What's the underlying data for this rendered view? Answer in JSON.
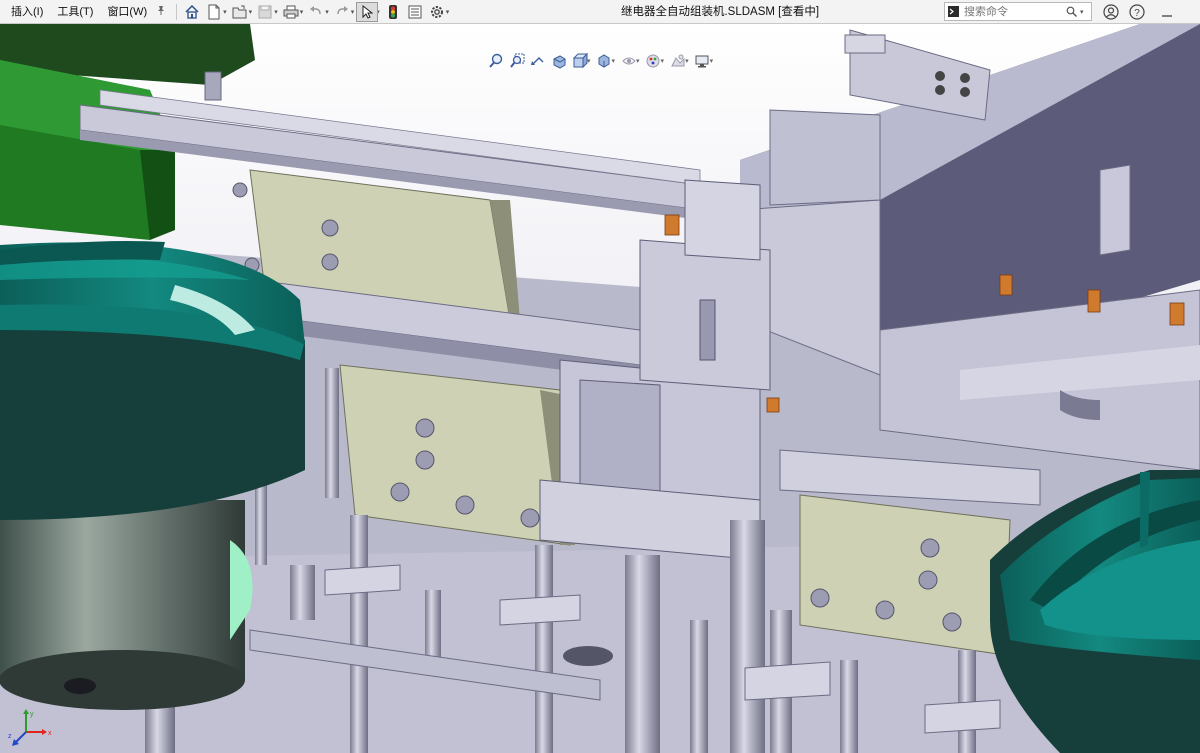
{
  "menu": {
    "items": [
      {
        "label": "插入(I)"
      },
      {
        "label": "工具(T)"
      },
      {
        "label": "窗口(W)"
      }
    ],
    "pin_icon": "pin-icon"
  },
  "toolbar": {
    "icons": [
      "home-icon",
      "new-file-icon",
      "open-file-icon",
      "save-icon",
      "print-icon",
      "undo-icon",
      "redo-icon",
      "select-icon",
      "traffic-light-icon",
      "file-properties-icon",
      "options-gear-icon"
    ]
  },
  "window": {
    "title": "继电器全自动组装机.SLDASM [查看中]"
  },
  "search": {
    "placeholder": "搜索命令"
  },
  "right_icons": [
    "user-icon",
    "help-icon",
    "minimize-icon"
  ],
  "heads_up_toolbar": {
    "icons": [
      "zoom-to-fit-icon",
      "zoom-area-icon",
      "previous-view-icon",
      "section-view-icon",
      "view-orientation-icon",
      "display-style-icon",
      "hide-show-icon",
      "appearance-icon",
      "scene-icon",
      "display-settings-icon"
    ]
  },
  "triad": {
    "axes": [
      "x",
      "y",
      "z"
    ]
  },
  "colors": {
    "toolbar_bg": "#f3f3f3",
    "part_grey": "#c3c3d4",
    "part_dark": "#7e7e99",
    "bowl_teal": "#0e7a72",
    "plate_olive": "#cfd1b4",
    "green_block": "#1f7a22",
    "copper": "#d07a2e"
  }
}
